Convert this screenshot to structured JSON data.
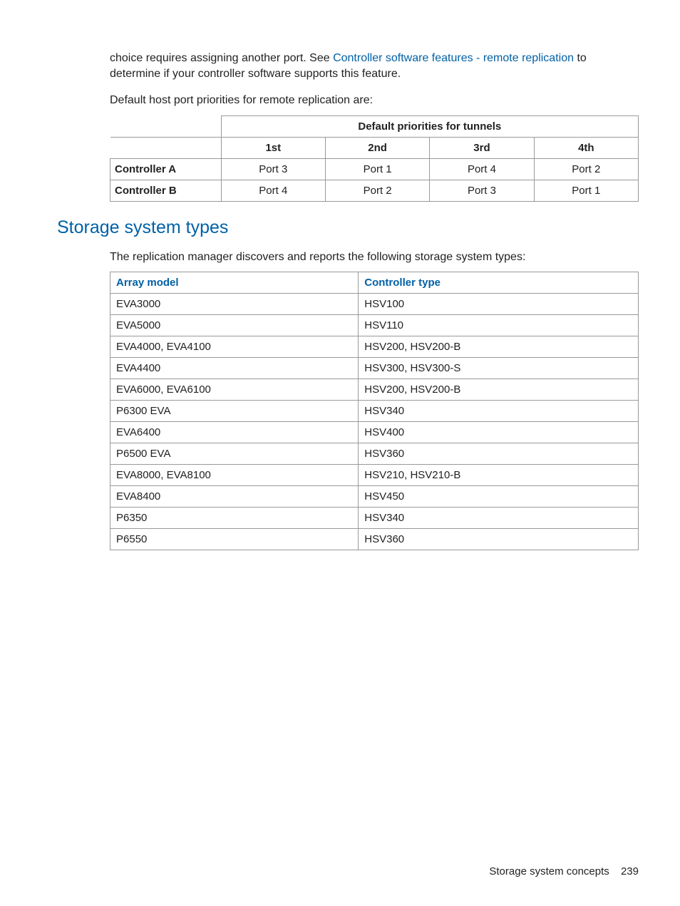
{
  "intro": {
    "p1_before_link": "choice requires assigning another port. See ",
    "link_text": "Controller software features - remote replication",
    "p1_after_link": " to determine if your controller software supports this feature.",
    "p2": "Default host port priorities for remote replication are:"
  },
  "priorities_table": {
    "group_header": "Default priorities for tunnels",
    "cols": [
      "1st",
      "2nd",
      "3rd",
      "4th"
    ],
    "rows": [
      {
        "label": "Controller A",
        "values": [
          "Port 3",
          "Port 1",
          "Port 4",
          "Port 2"
        ]
      },
      {
        "label": "Controller B",
        "values": [
          "Port 4",
          "Port 2",
          "Port 3",
          "Port 1"
        ]
      }
    ]
  },
  "section": {
    "heading": "Storage system types",
    "intro": "The replication manager discovers and reports the following storage system types:"
  },
  "storage_table": {
    "cols": [
      "Array model",
      "Controller type"
    ],
    "rows": [
      {
        "model": "EVA3000",
        "ctrl": "HSV100"
      },
      {
        "model": "EVA5000",
        "ctrl": "HSV110"
      },
      {
        "model": "EVA4000, EVA4100",
        "ctrl": "HSV200, HSV200-B"
      },
      {
        "model": "EVA4400",
        "ctrl": "HSV300, HSV300-S"
      },
      {
        "model": "EVA6000, EVA6100",
        "ctrl": "HSV200, HSV200-B"
      },
      {
        "model": "P6300 EVA",
        "ctrl": "HSV340"
      },
      {
        "model": "EVA6400",
        "ctrl": "HSV400"
      },
      {
        "model": "P6500 EVA",
        "ctrl": "HSV360"
      },
      {
        "model": "EVA8000, EVA8100",
        "ctrl": "HSV210, HSV210-B"
      },
      {
        "model": "EVA8400",
        "ctrl": "HSV450"
      },
      {
        "model": "P6350",
        "ctrl": "HSV340"
      },
      {
        "model": "P6550",
        "ctrl": "HSV360"
      }
    ]
  },
  "footer": {
    "text": "Storage system concepts",
    "page": "239"
  }
}
